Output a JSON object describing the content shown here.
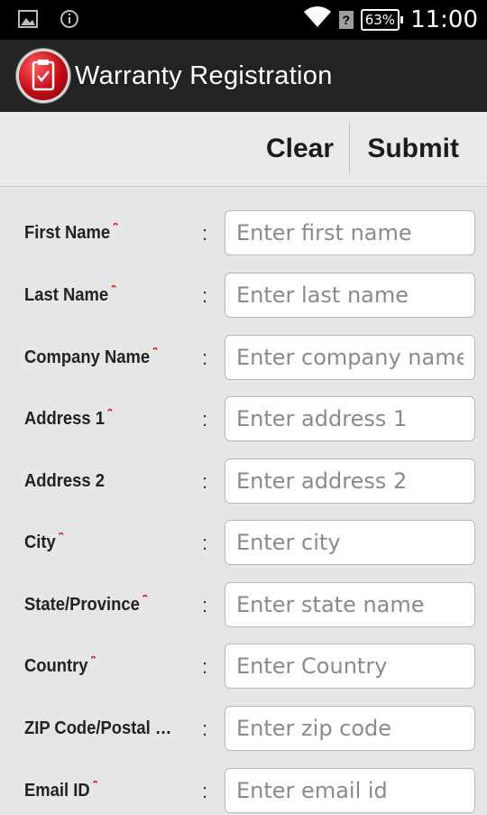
{
  "status_bar": {
    "time": "11:00",
    "battery": "63%",
    "icons": [
      "image-icon",
      "info-icon",
      "wifi-icon",
      "signal-unknown-icon",
      "battery-icon"
    ]
  },
  "action_bar": {
    "title": "Warranty Registration",
    "icon": "clipboard-check-icon"
  },
  "toolbar": {
    "clear_label": "Clear",
    "submit_label": "Submit"
  },
  "form": {
    "colon": ":",
    "required_marker": "*",
    "fields": [
      {
        "label": "First Name",
        "required": true,
        "placeholder": "Enter first name"
      },
      {
        "label": "Last Name",
        "required": true,
        "placeholder": "Enter last name"
      },
      {
        "label": "Company Name",
        "required": true,
        "placeholder": "Enter company name"
      },
      {
        "label": "Address 1",
        "required": true,
        "placeholder": "Enter address 1"
      },
      {
        "label": "Address 2",
        "required": false,
        "placeholder": "Enter address 2"
      },
      {
        "label": "City",
        "required": true,
        "placeholder": "Enter city"
      },
      {
        "label": "State/Province",
        "required": true,
        "placeholder": "Enter state name"
      },
      {
        "label": "Country",
        "required": true,
        "placeholder": "Enter Country"
      },
      {
        "label": "ZIP Code/Postal C…",
        "required": false,
        "placeholder": "Enter zip code"
      },
      {
        "label": "Email ID",
        "required": true,
        "placeholder": "Enter email id"
      }
    ]
  },
  "colors": {
    "accent_red": "#d50f1c",
    "status_bar": "#000000",
    "action_bar": "#232323",
    "background": "#e6e6e6"
  }
}
